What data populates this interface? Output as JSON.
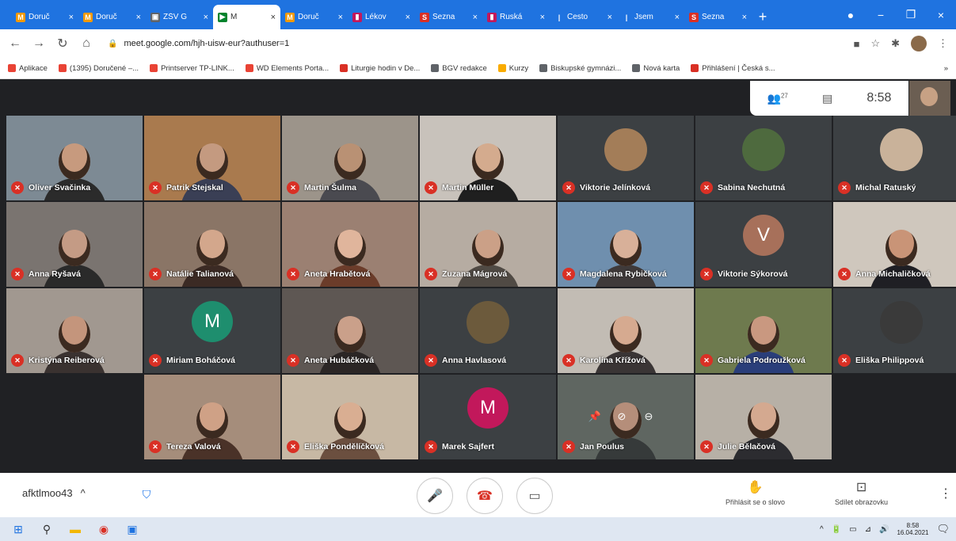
{
  "browser": {
    "tabs": [
      {
        "label": "Doruč",
        "fav": "M",
        "color": "#f29900"
      },
      {
        "label": "Doruč",
        "fav": "M",
        "color": "#f29900"
      },
      {
        "label": "ZŠV G",
        "fav": "▣",
        "color": "#5f6368"
      },
      {
        "label": "M",
        "fav": "▶",
        "color": "#00832d",
        "active": true
      },
      {
        "label": "Doruč",
        "fav": "M",
        "color": "#f29900"
      },
      {
        "label": "Lékov",
        "fav": "▮",
        "color": "#c2185b"
      },
      {
        "label": "Sezna",
        "fav": "S",
        "color": "#d93025"
      },
      {
        "label": "Ruská",
        "fav": "▮",
        "color": "#c2185b"
      },
      {
        "label": "Cesto",
        "fav": "|",
        "color": "#1f73e0"
      },
      {
        "label": "Jsem",
        "fav": "|",
        "color": "#1f73e0"
      },
      {
        "label": "Sezna",
        "fav": "S",
        "color": "#d93025"
      }
    ],
    "tab_close": "×",
    "new_tab": "+",
    "window_controls": [
      "●",
      "−",
      "❐",
      "×"
    ],
    "url": "meet.google.com/hjh-uisw-eur?authuser=1",
    "bookmarks": [
      {
        "label": "Aplikace",
        "color": "#e94335"
      },
      {
        "label": "(1395) Doručené –...",
        "color": "#e94335"
      },
      {
        "label": "Printserver TP-LINK...",
        "color": "#e94335"
      },
      {
        "label": "WD Elements Porta...",
        "color": "#e94335"
      },
      {
        "label": "Liturgie hodin v De...",
        "color": "#d93025"
      },
      {
        "label": "BGV redakce",
        "color": "#5f6368"
      },
      {
        "label": "Kurzy",
        "color": "#f9ab00"
      },
      {
        "label": "Biskupské gymnázi...",
        "color": "#5f6368"
      },
      {
        "label": "Nová karta",
        "color": "#5f6368"
      },
      {
        "label": "Přihlášení | Česká s...",
        "color": "#d93025"
      }
    ],
    "bookmarks_more": "»"
  },
  "meet": {
    "participant_count": "27",
    "clock": "8:58",
    "tiles": [
      {
        "name": "Oliver Svačinka",
        "type": "video",
        "bg": "#7d8a94",
        "skin": "#c79a7e",
        "shirt": "#2b2b2b"
      },
      {
        "name": "Patrik Stejskal",
        "type": "video",
        "bg": "#a97a4e",
        "skin": "#c49a80",
        "shirt": "#3a3f55"
      },
      {
        "name": "Martin Šulma",
        "type": "video",
        "bg": "#9c948a",
        "skin": "#b99174",
        "shirt": "#4a4a50"
      },
      {
        "name": "Martin Müller",
        "type": "video",
        "bg": "#c8c2bb",
        "skin": "#d4ab8e",
        "shirt": "#1f1f1f"
      },
      {
        "name": "Viktorie Jelínková",
        "type": "photo",
        "photo": "#a37d58"
      },
      {
        "name": "Sabina Nechutná",
        "type": "photo",
        "photo": "#4e6a3e"
      },
      {
        "name": "Michal Ratuský",
        "type": "photo",
        "photo": "#c9b29a"
      },
      {
        "name": "Anna Ryšavá",
        "type": "video",
        "bg": "#7a7470",
        "skin": "#c49b85",
        "shirt": "#2a2a2a"
      },
      {
        "name": "Natálie Talianová",
        "type": "video",
        "bg": "#8a7566",
        "skin": "#d3a78c",
        "shirt": "#3b2a24"
      },
      {
        "name": "Aneta Hrabětová",
        "type": "video",
        "bg": "#9b8072",
        "skin": "#e0b59c",
        "shirt": "#6b3c2a"
      },
      {
        "name": "Zuzana Mágrová",
        "type": "video",
        "bg": "#b6aca2",
        "skin": "#cba087",
        "shirt": "#504a44"
      },
      {
        "name": "Magdalena Rybičková",
        "type": "video",
        "bg": "#6f8fae",
        "skin": "#d8b099",
        "shirt": "#3f3a3a"
      },
      {
        "name": "Viktorie Sýkorová",
        "type": "letter",
        "letter": "V",
        "color": "#a7705a"
      },
      {
        "name": "Anna Michaličková",
        "type": "video",
        "bg": "#cfc7bd",
        "skin": "#c99477",
        "shirt": "#1f1f24"
      },
      {
        "name": "Kristýna Reiberová",
        "type": "video",
        "bg": "#a19890",
        "skin": "#c4957c",
        "shirt": "#3a3230"
      },
      {
        "name": "Miriam Boháčová",
        "type": "letter",
        "letter": "M",
        "color": "#1e8e6e"
      },
      {
        "name": "Aneta Hubáčková",
        "type": "video",
        "bg": "#5e5753",
        "skin": "#caa08a",
        "shirt": "#2b2625"
      },
      {
        "name": "Anna Havlasová",
        "type": "photo",
        "photo": "#6c5a3c"
      },
      {
        "name": "Karolína Křížová",
        "type": "video",
        "bg": "#c2bcb4",
        "skin": "#d6aa90",
        "shirt": "#3a3535"
      },
      {
        "name": "Gabriela Podroužková",
        "type": "video",
        "bg": "#6e7a4e",
        "skin": "#c99880",
        "shirt": "#2a3e7a"
      },
      {
        "name": "Eliška Philippová",
        "type": "photo",
        "photo": "#3a3a3a"
      },
      {
        "name": "",
        "type": "empty"
      },
      {
        "name": "Tereza Valová",
        "type": "video",
        "bg": "#a58d7b",
        "skin": "#cfa186",
        "shirt": "#4a3228"
      },
      {
        "name": "Eliška Pondělíčková",
        "type": "video",
        "bg": "#c7b8a4",
        "skin": "#d9ae92",
        "shirt": "#6b4f3f"
      },
      {
        "name": "Marek Sajfert",
        "type": "letter",
        "letter": "M",
        "color": "#c2185b"
      },
      {
        "name": "Jan Poulus",
        "type": "video",
        "bg": "#5f6661",
        "skin": "#b58e7a",
        "shirt": "#363a3a",
        "hover": true
      },
      {
        "name": "Julie Bělačová",
        "type": "video",
        "bg": "#b7b0a6",
        "skin": "#d4a990",
        "shirt": "#2c2c30"
      },
      {
        "name": "",
        "type": "empty"
      }
    ],
    "hover_icons": [
      "📌",
      "⊘",
      "⊖"
    ],
    "meeting_code": "afktlmoo43",
    "meeting_code_chevron": "^",
    "controls": {
      "mic": "🎤",
      "hangup": "☎",
      "camera": "▭"
    },
    "raise_hand": {
      "icon": "✋",
      "label": "Přihlásit se o slovo"
    },
    "present": {
      "icon": "⊡",
      "label": "Sdílet obrazovku"
    },
    "more": "⋮"
  },
  "taskbar": {
    "items": [
      {
        "icon": "⊞",
        "color": "#1f73e0"
      },
      {
        "icon": "⚲",
        "color": "#333"
      },
      {
        "icon": "▬",
        "color": "#f2b705"
      },
      {
        "icon": "◉",
        "color": "#d93025"
      },
      {
        "icon": "▣",
        "color": "#1f73e0"
      }
    ],
    "tray": [
      "^",
      "🔋",
      "▭",
      "⊿",
      "🔊"
    ],
    "time": "8:58",
    "date": "16.04.2021",
    "notification": "🗨"
  }
}
